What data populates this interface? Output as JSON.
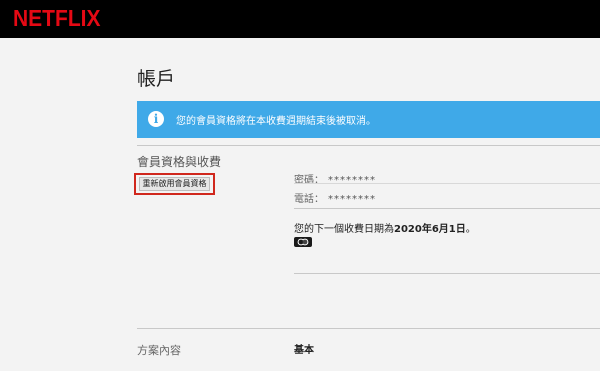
{
  "header": {
    "logo_text": "NETFLIX",
    "brand_color": "#e50914"
  },
  "page": {
    "title": "帳戶"
  },
  "banner": {
    "icon": "info-icon",
    "message": "您的會員資格將在本收費週期結束後被取消。",
    "color": "#3fa9e8"
  },
  "membership": {
    "section_title": "會員資格與收費",
    "restart_button_label": "重新啟用會員資格",
    "password_label": "密碼：",
    "password_value": "********",
    "phone_label": "電話：",
    "phone_value": "********",
    "next_billing_prefix": "您的下一個收費日期為",
    "next_billing_date": "2020年6月1日",
    "next_billing_suffix": "。",
    "payment_icon": "mastercard-icon",
    "highlight_color": "#d0271d"
  },
  "plan": {
    "label": "方案內容",
    "value": "基本"
  }
}
